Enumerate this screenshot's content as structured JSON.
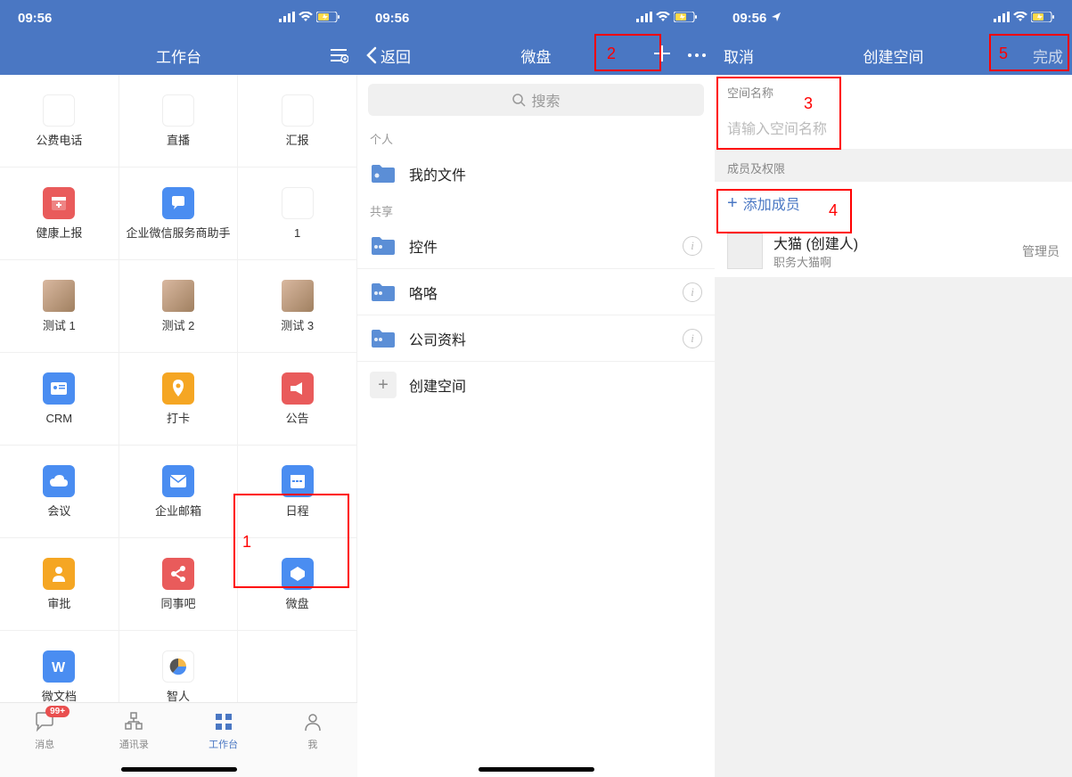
{
  "status": {
    "time": "09:56",
    "location_icon": "▶"
  },
  "screen1": {
    "title": "工作台",
    "apps": [
      {
        "label": "公费电话",
        "color": "#fff",
        "icon": "phone"
      },
      {
        "label": "直播",
        "color": "#fff",
        "icon": "live"
      },
      {
        "label": "汇报",
        "color": "#fff",
        "icon": "report"
      },
      {
        "label": "健康上报",
        "color": "#e95b5b",
        "icon": "cal-plus"
      },
      {
        "label": "企业微信服务商助手",
        "color": "#4a8df1",
        "icon": "chat"
      },
      {
        "label": "1",
        "color": "#fff",
        "icon": "doc"
      },
      {
        "label": "测试 1",
        "color": "photo",
        "icon": "p1"
      },
      {
        "label": "测试 2",
        "color": "photo",
        "icon": "p2"
      },
      {
        "label": "测试 3",
        "color": "photo",
        "icon": "p3"
      },
      {
        "label": "CRM",
        "color": "#4a8df1",
        "icon": "card"
      },
      {
        "label": "打卡",
        "color": "#f5a623",
        "icon": "pin"
      },
      {
        "label": "公告",
        "color": "#e95b5b",
        "icon": "horn"
      },
      {
        "label": "会议",
        "color": "#4a8df1",
        "icon": "cloud"
      },
      {
        "label": "企业邮箱",
        "color": "#4a8df1",
        "icon": "mail"
      },
      {
        "label": "日程",
        "color": "#4a8df1",
        "icon": "cal"
      },
      {
        "label": "审批",
        "color": "#f5a623",
        "icon": "user"
      },
      {
        "label": "同事吧",
        "color": "#e95b5b",
        "icon": "share"
      },
      {
        "label": "微盘",
        "color": "#4a8df1",
        "icon": "disk"
      },
      {
        "label": "微文档",
        "color": "#4a8df1",
        "icon": "W"
      },
      {
        "label": "智人",
        "color": "#fff",
        "icon": "pie"
      }
    ],
    "tabs": [
      {
        "label": "消息",
        "badge": "99+"
      },
      {
        "label": "通讯录"
      },
      {
        "label": "工作台"
      },
      {
        "label": "我"
      }
    ],
    "annotation": "1"
  },
  "screen2": {
    "back": "返回",
    "title": "微盘",
    "search_placeholder": "搜索",
    "sec_personal": "个人",
    "my_files": "我的文件",
    "sec_shared": "共享",
    "shared": [
      {
        "label": "控件"
      },
      {
        "label": "咯咯"
      },
      {
        "label": "公司资料"
      }
    ],
    "create_space": "创建空间",
    "annotation": "2"
  },
  "screen3": {
    "cancel": "取消",
    "title": "创建空间",
    "done": "完成",
    "name_header": "空间名称",
    "name_placeholder": "请输入空间名称",
    "member_header": "成员及权限",
    "add_member": "添加成员",
    "member_name": "大猫 (创建人)",
    "member_role": "职务大猫啊",
    "member_perm": "管理员",
    "annotation_a": "3",
    "annotation_b": "4",
    "annotation_c": "5"
  }
}
